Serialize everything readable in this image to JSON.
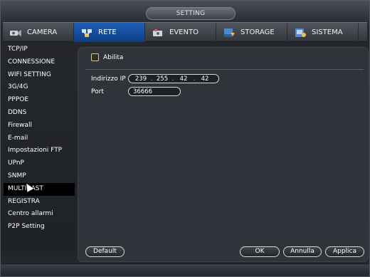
{
  "window": {
    "title": "SETTING"
  },
  "tabs": [
    {
      "label": "CAMERA",
      "icon": "camera-icon"
    },
    {
      "label": "RETE",
      "icon": "network-icon"
    },
    {
      "label": "EVENTO",
      "icon": "event-icon"
    },
    {
      "label": "STORAGE",
      "icon": "storage-icon"
    },
    {
      "label": "SISTEMA",
      "icon": "system-icon"
    }
  ],
  "active_tab": "RETE",
  "sidebar": {
    "items": [
      {
        "label": "TCP/IP"
      },
      {
        "label": "CONNESSIONE"
      },
      {
        "label": "WIFI SETTING"
      },
      {
        "label": "3G/4G"
      },
      {
        "label": "PPPOE"
      },
      {
        "label": "DDNS"
      },
      {
        "label": "Firewall"
      },
      {
        "label": "E-mail"
      },
      {
        "label": "Impostazioni FTP"
      },
      {
        "label": "UPnP"
      },
      {
        "label": "SNMP"
      },
      {
        "label": "MULTICAST"
      },
      {
        "label": "REGISTRA"
      },
      {
        "label": "Centro allarmi"
      },
      {
        "label": "P2P Setting"
      }
    ],
    "active_item": "MULTICAST"
  },
  "form": {
    "enable_label": "Abilita",
    "enable_checked": false,
    "ip_label": "Indirizzo IP",
    "ip": [
      "239",
      "255",
      "42",
      "42"
    ],
    "port_label": "Port",
    "port": "36666"
  },
  "buttons": {
    "default": "Default",
    "ok": "OK",
    "cancel": "Annulla",
    "apply": "Applica"
  },
  "colors": {
    "active_tab": "#1d5fb8",
    "checkbox_border": "#e0d060",
    "active_sidebar": "#000000"
  }
}
